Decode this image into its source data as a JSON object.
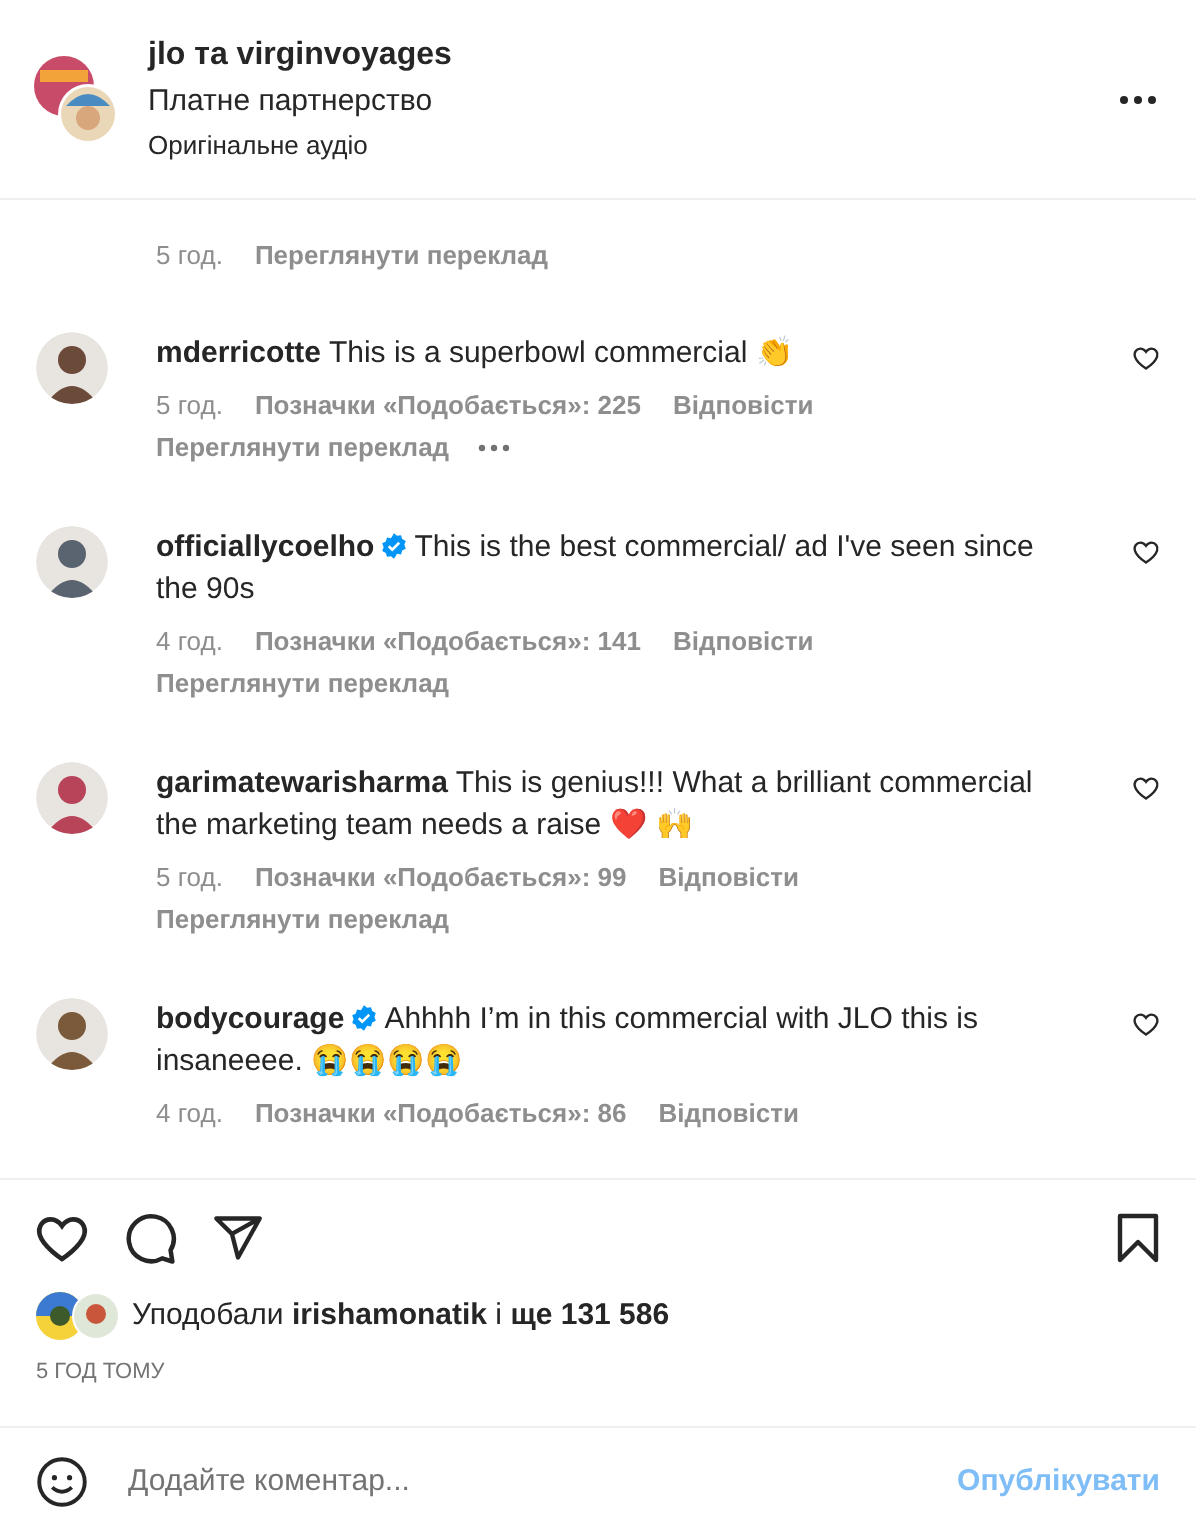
{
  "header": {
    "title": "jlo та virginvoyages",
    "subtitle": "Платне партнерство",
    "audio": "Оригінальне аудіо"
  },
  "partial_comment": {
    "time": "5 год.",
    "translate": "Переглянути переклад"
  },
  "comments": [
    {
      "user": "mderricotte",
      "verified": false,
      "text": "This is a superbowl commercial 👏",
      "time": "5 год.",
      "likes": "Позначки «Подобається»: 225",
      "reply": "Відповісти",
      "translate": "Переглянути переклад",
      "more": true
    },
    {
      "user": "officiallycoelho",
      "verified": true,
      "text": "This is the best commercial/ ad I've seen since the 90s",
      "time": "4 год.",
      "likes": "Позначки «Подобається»: 141",
      "reply": "Відповісти",
      "translate": "Переглянути переклад",
      "more": false
    },
    {
      "user": "garimatewarisharma",
      "verified": false,
      "text": "This is genius!!! What a brilliant commercial the marketing team needs a raise ❤️ 🙌",
      "time": "5 год.",
      "likes": "Позначки «Подобається»: 99",
      "reply": "Відповісти",
      "translate": "Переглянути переклад",
      "more": false
    },
    {
      "user": "bodycourage",
      "verified": true,
      "text": "Ahhhh I’m in this commercial with JLO this is insaneeee. 😭😭😭😭",
      "time": "4 год.",
      "likes": "Позначки «Подобається»: 86",
      "reply": "Відповісти",
      "more": false
    }
  ],
  "likes": "Уподобали **irishamonatik** і **ще 131 586**",
  "posted": "5 ГОД ТОМУ",
  "comment_box": {
    "placeholder": "Додайте коментар...",
    "post": "Опублікувати"
  }
}
